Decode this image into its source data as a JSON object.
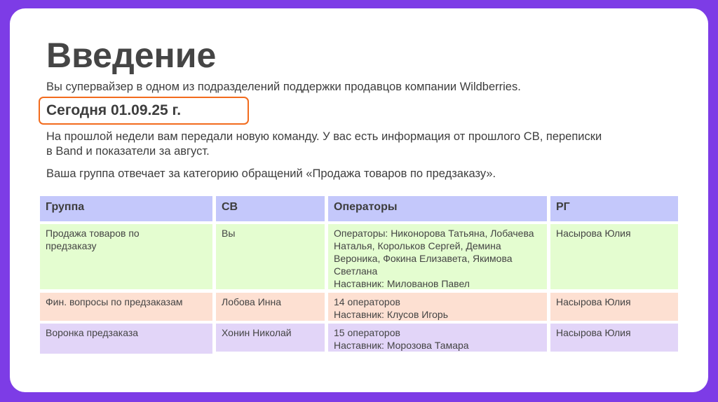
{
  "title": "Введение",
  "intro": "Вы супервайзер в одном из подразделений поддержки продавцов компании Wildberries.",
  "today": "Сегодня 01.09.25 г.",
  "paragraph1": "На прошлой недели вам передали новую команду. У вас есть информация от прошлого СВ, переписки в Band и показатели за август.",
  "paragraph2": "Ваша группа отвечает за категорию обращений «Продажа товаров по предзаказу».",
  "table": {
    "headers": [
      "Группа",
      "СВ",
      "Операторы",
      "РГ"
    ],
    "rows": [
      {
        "group": "Продажа товаров по предзаказу",
        "sv": "Вы",
        "operators": [
          "Операторы: Никонорова Татьяна, Лобачева Наталья, Корольков Сергей, Демина Вероника, Фокина Елизавета, Якимова Светлана",
          "Наставник: Милованов Павел"
        ],
        "rg": "Насырова Юлия"
      },
      {
        "group": "Фин. вопросы по предзаказам",
        "sv": "Лобова Инна",
        "operators": [
          "14 операторов",
          "Наставник: Клусов Игорь"
        ],
        "rg": "Насырова Юлия"
      },
      {
        "group": "Воронка предзаказа",
        "sv": "Хонин Николай",
        "operators": [
          "15 операторов",
          "Наставник: Морозова Тамара"
        ],
        "rg": "Насырова Юлия"
      }
    ]
  }
}
